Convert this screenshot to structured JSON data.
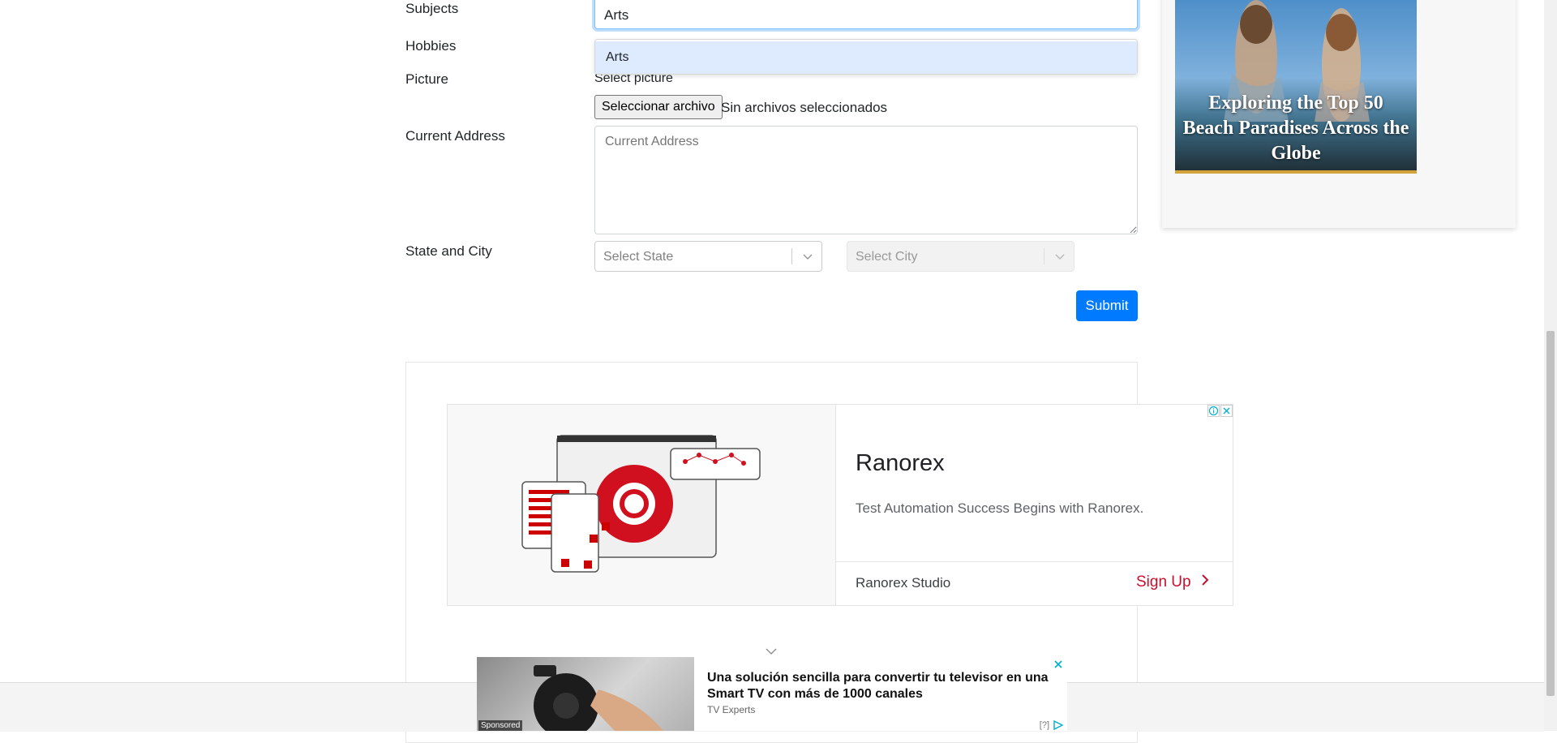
{
  "form": {
    "subjects_label": "Subjects",
    "subjects_value": "Arts",
    "subjects_option": "Arts",
    "hobbies_label": "Hobbies",
    "picture_label": "Picture",
    "picture_select_text": "Select picture",
    "file_button_label": "Seleccionar archivo",
    "file_status": "Sin archivos seleccionados",
    "address_label": "Current Address",
    "address_placeholder": "Current Address",
    "state_city_label": "State and City",
    "state_placeholder": "Select State",
    "city_placeholder": "Select City",
    "submit_label": "Submit"
  },
  "side_ad": {
    "headline": "Exploring the Top 50 Beach Paradises Across the Globe"
  },
  "ranorex_ad": {
    "brand": "Ranorex",
    "tagline": "Test Automation Success Begins with Ranorex.",
    "product": "Ranorex Studio",
    "cta": "Sign Up",
    "cta_color": "#c8102e"
  },
  "bottom_ad": {
    "title": "Una solución sencilla para convertir tu televisor en una Smart TV con más de 1000 canales",
    "source": "TV Experts",
    "sponsored": "Sponsored",
    "help": "[?]"
  },
  "colors": {
    "accent": "#007bff",
    "focus_border": "#80bdff",
    "option_highlight": "#deebff"
  }
}
